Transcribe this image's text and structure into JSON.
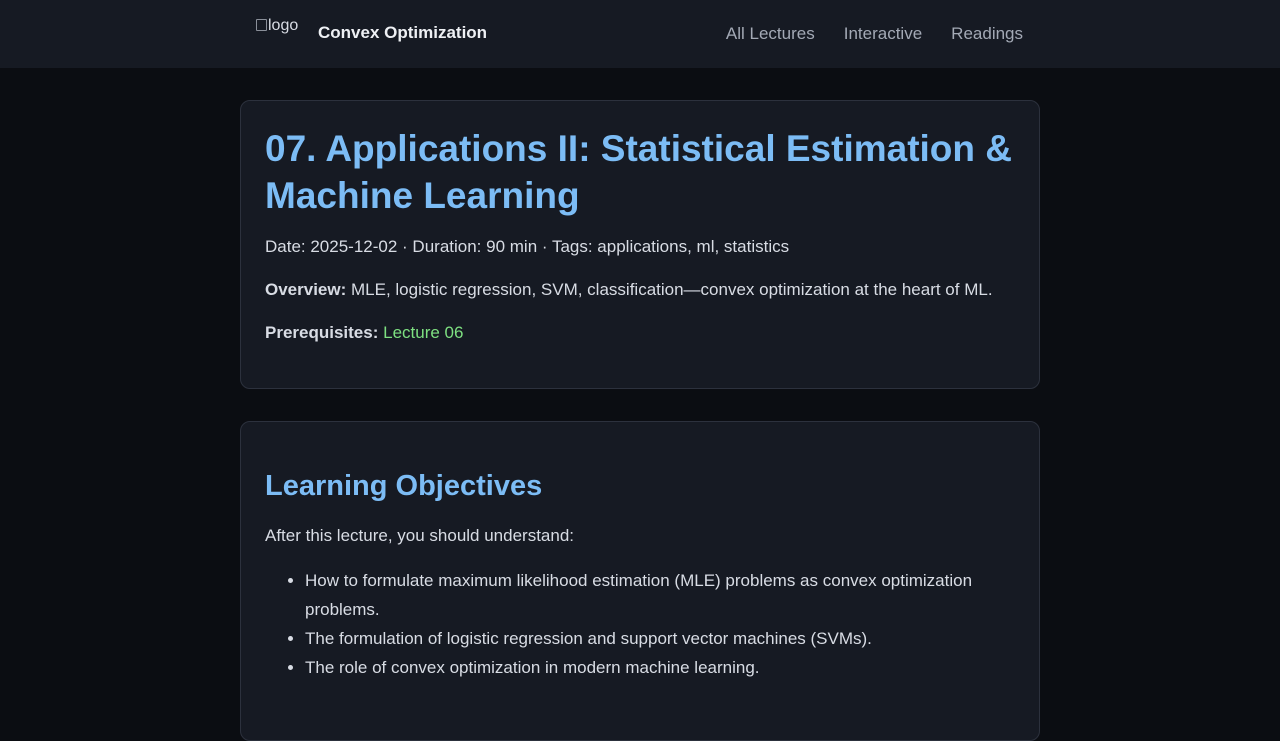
{
  "header": {
    "logo_alt": "logo",
    "site_title": "Convex Optimization",
    "nav": [
      {
        "label": "All Lectures"
      },
      {
        "label": "Interactive"
      },
      {
        "label": "Readings"
      }
    ]
  },
  "lecture": {
    "title": "07. Applications II: Statistical Estimation & Machine Learning",
    "meta": "Date: 2025-12-02 · Duration: 90 min · Tags: applications, ml, statistics",
    "overview_label": "Overview:",
    "overview_text": " MLE, logistic regression, SVM, classification—convex optimization at the heart of ML.",
    "prereq_label": "Prerequisites:",
    "prereq_link": "Lecture 06"
  },
  "objectives": {
    "heading": "Learning Objectives",
    "intro": "After this lecture, you should understand:",
    "items": [
      "How to formulate maximum likelihood estimation (MLE) problems as convex optimization problems.",
      "The formulation of logistic regression and support vector machines (SVMs).",
      "The role of convex optimization in modern machine learning."
    ]
  },
  "colors": {
    "background": "#0b0d12",
    "card": "#161a23",
    "accent_title": "#7cbcf5",
    "link_green": "#7ee081",
    "nav_text": "#a3a9b5"
  }
}
